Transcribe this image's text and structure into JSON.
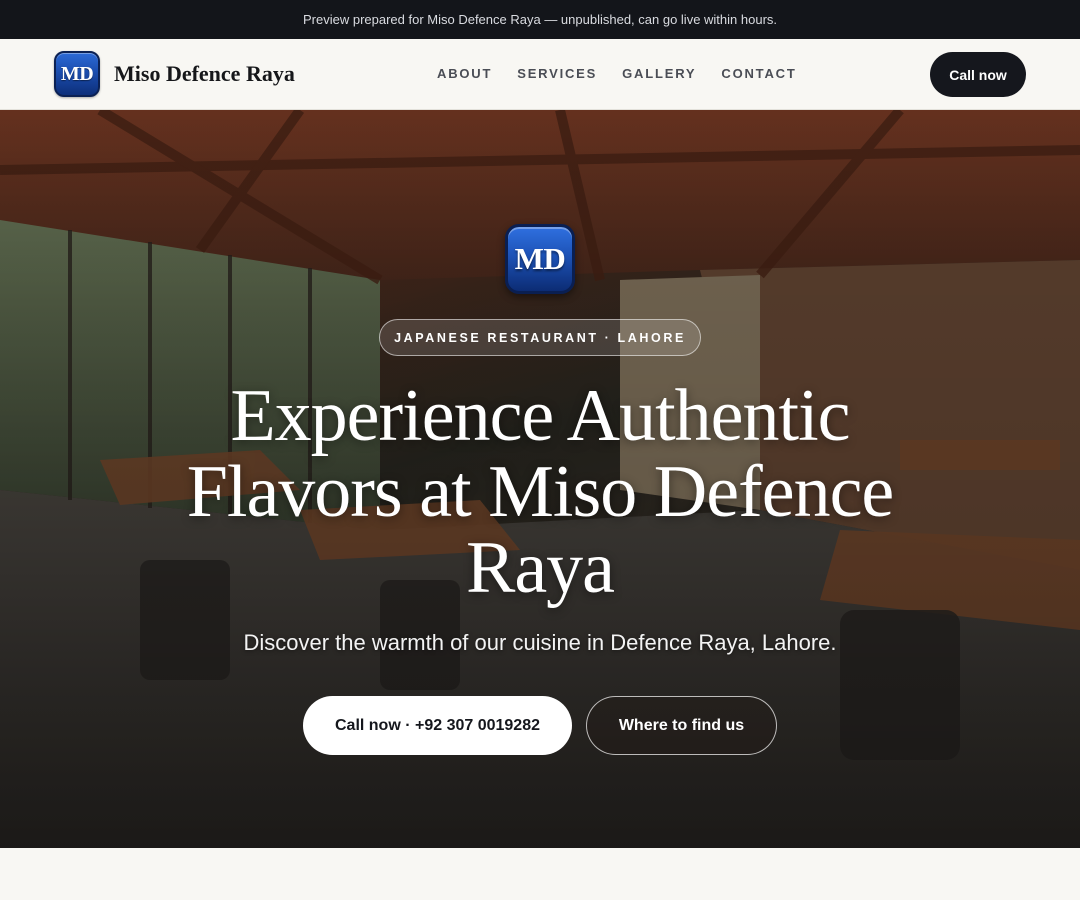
{
  "topbar": {
    "message": "Preview prepared for Miso Defence Raya — unpublished, can go live within hours."
  },
  "header": {
    "logo_text": "MD",
    "brand_name": "Miso Defence Raya",
    "nav": [
      {
        "label": "ABOUT"
      },
      {
        "label": "SERVICES"
      },
      {
        "label": "GALLERY"
      },
      {
        "label": "CONTACT"
      }
    ],
    "cta_label": "Call now"
  },
  "hero": {
    "logo_text": "MD",
    "tagline": "JAPANESE RESTAURANT · LAHORE",
    "title": "Experience Authentic Flavors at Miso Defence Raya",
    "subtitle": "Discover the warmth of our cuisine in Defence Raya, Lahore.",
    "primary_button": "Call now · +92 307 0019282",
    "secondary_button": "Where to find us",
    "background_image": "restaurant-interior-photo"
  },
  "colors": {
    "topbar_bg": "#13151a",
    "logo_blue": "#1d52b6",
    "cta_bg": "#15171d",
    "page_bg": "#f8f7f3"
  }
}
